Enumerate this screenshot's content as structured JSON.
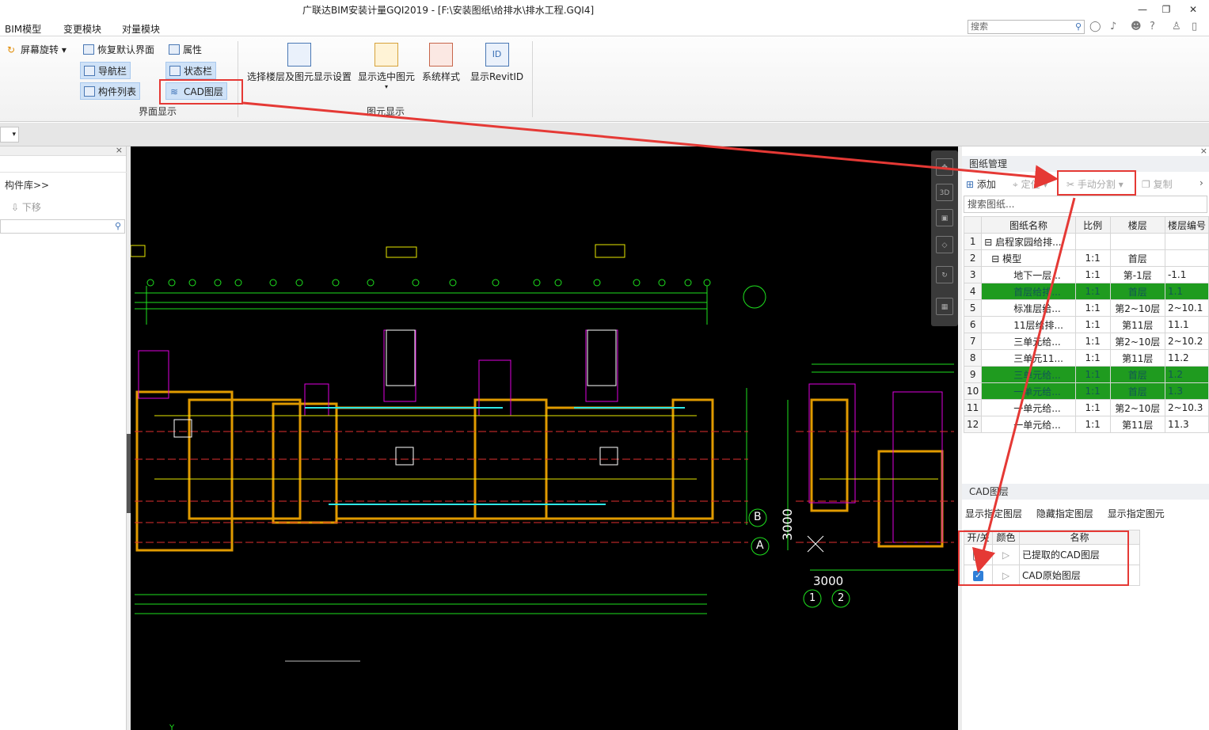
{
  "window": {
    "title": "广联达BIM安装计量GQI2019 - [F:\\安装图纸\\给排水\\排水工程.GQI4]",
    "restore_icon": "restore-icon",
    "close_icon": "close-icon"
  },
  "menu": {
    "tabs": [
      "BIM模型",
      "变更模块",
      "对量模块"
    ],
    "search_placeholder": "搜索"
  },
  "ribbon": {
    "rotate": "屏幕旋转",
    "restore_default": "恢复默认界面",
    "navbar": "导航栏",
    "component_list": "构件列表",
    "properties": "属性",
    "statusbar": "状态栏",
    "cad_layer": "CAD图层",
    "group_interface": "界面显示",
    "select_floor": "选择楼层及图元显示设置",
    "show_selected": "显示选中图元",
    "system_style": "系统样式",
    "show_revit_id": "显示RevitID",
    "group_elements": "图元显示"
  },
  "left_panel": {
    "library": "构件库>>",
    "move_down": "下移"
  },
  "canvas": {
    "dim_3000_v": "3000",
    "dim_3000_h": "3000",
    "axis_b": "B",
    "axis_a": "A",
    "axis_1": "1",
    "axis_2": "2"
  },
  "drawing_mgmt": {
    "title": "图纸管理",
    "add": "添加",
    "locate": "定位",
    "manual_split": "手动分割",
    "copy": "复制",
    "search_placeholder": "搜索图纸...",
    "columns": [
      "图纸名称",
      "比例",
      "楼层",
      "楼层编号"
    ],
    "rows": [
      {
        "n": "1",
        "name": "启程家园给排...",
        "scale": "",
        "floor": "",
        "code": ""
      },
      {
        "n": "2",
        "name": "模型",
        "scale": "1:1",
        "floor": "首层",
        "code": ""
      },
      {
        "n": "3",
        "name": "地下一层...",
        "scale": "1:1",
        "floor": "第-1层",
        "code": "-1.1"
      },
      {
        "n": "4",
        "name": "首层给排...",
        "scale": "1:1",
        "floor": "首层",
        "code": "1.1"
      },
      {
        "n": "5",
        "name": "标准层给...",
        "scale": "1:1",
        "floor": "第2~10层",
        "code": "2~10.1"
      },
      {
        "n": "6",
        "name": "11层给排...",
        "scale": "1:1",
        "floor": "第11层",
        "code": "11.1"
      },
      {
        "n": "7",
        "name": "三单元给...",
        "scale": "1:1",
        "floor": "第2~10层",
        "code": "2~10.2"
      },
      {
        "n": "8",
        "name": "三单元11...",
        "scale": "1:1",
        "floor": "第11层",
        "code": "11.2"
      },
      {
        "n": "9",
        "name": "三单元给...",
        "scale": "1:1",
        "floor": "首层",
        "code": "1.2"
      },
      {
        "n": "10",
        "name": "一单元给...",
        "scale": "1:1",
        "floor": "首层",
        "code": "1.3"
      },
      {
        "n": "11",
        "name": "一单元给...",
        "scale": "1:1",
        "floor": "第2~10层",
        "code": "2~10.3"
      },
      {
        "n": "12",
        "name": "一单元给...",
        "scale": "1:1",
        "floor": "第11层",
        "code": "11.3"
      }
    ],
    "highlight_color": "#1f9b1f"
  },
  "cad_layers": {
    "title": "CAD图层",
    "show_specified": "显示指定图层",
    "hide_specified": "隐藏指定图层",
    "show_specified_elements": "显示指定图元",
    "columns": [
      "开/关",
      "颜色",
      "名称"
    ],
    "rows": [
      {
        "name": "已提取的CAD图层",
        "checked": false
      },
      {
        "name": "CAD原始图层",
        "checked": true
      }
    ]
  },
  "annotation_color": "#e53935"
}
